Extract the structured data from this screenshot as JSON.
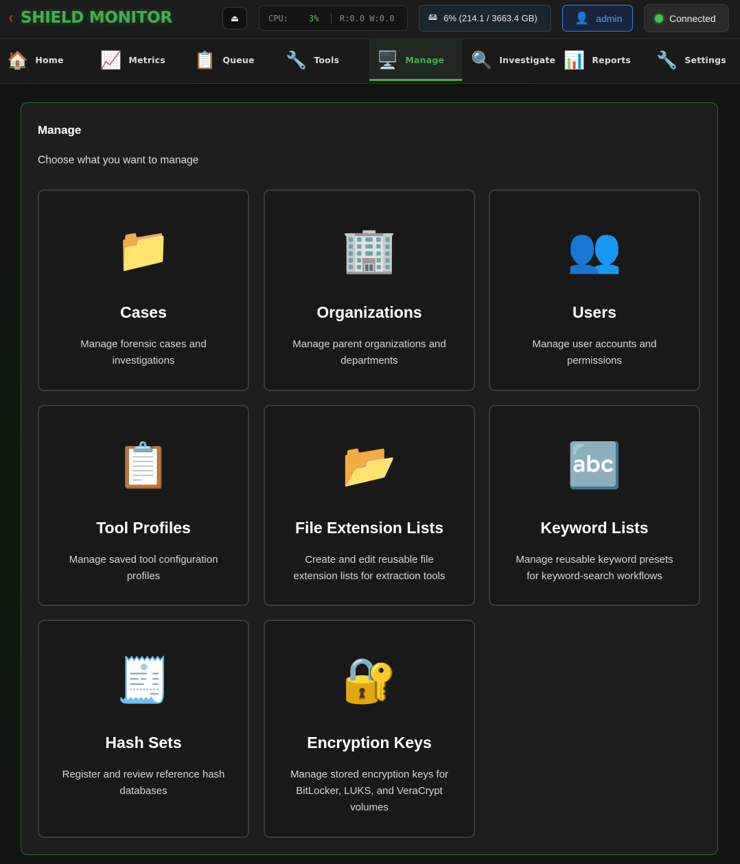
{
  "header": {
    "brand_chevron": "‹",
    "brand_title": "SHIELD MONITOR",
    "eject_icon": "⏏",
    "cpu_label": "CPU:",
    "cpu_value": "3%",
    "io_text": "R:0.0 W:0.0",
    "disk_icon": "🖴",
    "disk_text": "6% (214.1 / 3663.4 GB)",
    "user_icon": "👤",
    "user_label": "admin",
    "connection_label": "Connected",
    "colors": {
      "brand": "#3fb14a",
      "accent_blue": "#3b82d6",
      "connected": "#43c24f"
    }
  },
  "nav": {
    "items": [
      {
        "label": "Home",
        "icon": "🏠",
        "icon_name": "home-icon"
      },
      {
        "label": "Metrics",
        "icon": "📈",
        "icon_name": "chart-increasing-icon"
      },
      {
        "label": "Queue",
        "icon": "📋",
        "icon_name": "clipboard-icon"
      },
      {
        "label": "Tools",
        "icon": "🔧",
        "icon_name": "wrench-icon"
      },
      {
        "label": "Manage",
        "icon": "🖥️",
        "icon_name": "desktop-computer-icon"
      },
      {
        "label": "Investigate",
        "icon": "🔍",
        "icon_name": "magnifier-icon"
      },
      {
        "label": "Reports",
        "icon": "📊",
        "icon_name": "bar-chart-icon"
      },
      {
        "label": "Settings",
        "icon": "🔧",
        "icon_name": "wrench-icon"
      }
    ],
    "active": "Manage"
  },
  "main": {
    "title": "Manage",
    "subtitle": "Choose what you want to manage",
    "cards": [
      {
        "title": "Cases",
        "icon": "📁",
        "icon_name": "folder-icon",
        "description": "Manage forensic cases and investigations"
      },
      {
        "title": "Organizations",
        "icon": "🏢",
        "icon_name": "office-building-icon",
        "description": "Manage parent organizations and departments"
      },
      {
        "title": "Users",
        "icon": "👥",
        "icon_name": "users-icon",
        "description": "Manage user accounts and permissions"
      },
      {
        "title": "Tool Profiles",
        "icon": "📋",
        "icon_name": "clipboard-icon",
        "description": "Manage saved tool configuration profiles"
      },
      {
        "title": "File Extension Lists",
        "icon": "📂",
        "icon_name": "open-folder-icon",
        "description": "Create and edit reusable file extension lists for extraction tools"
      },
      {
        "title": "Keyword Lists",
        "icon": "🔤",
        "icon_name": "abc-icon",
        "description": "Manage reusable keyword presets for keyword-search workflows"
      },
      {
        "title": "Hash Sets",
        "icon": "🧾",
        "icon_name": "receipt-icon",
        "description": "Register and review reference hash databases"
      },
      {
        "title": "Encryption Keys",
        "icon": "🔐",
        "icon_name": "lock-with-key-icon",
        "description": "Manage stored encryption keys for BitLocker, LUKS, and VeraCrypt volumes"
      }
    ]
  }
}
